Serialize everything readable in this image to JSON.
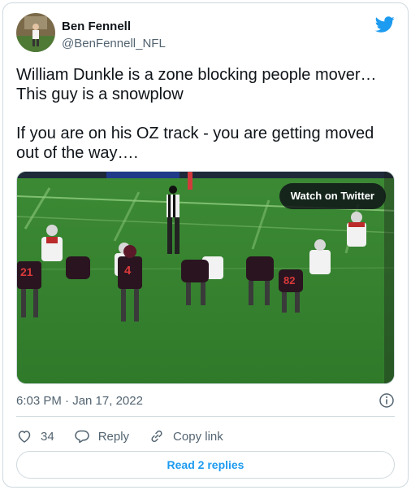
{
  "author": {
    "name": "Ben Fennell",
    "handle": "@BenFennell_NFL"
  },
  "tweet": {
    "text": "William Dunkle is a zone blocking people mover…\nThis guy is a snowplow\n\nIf you are on his OZ track - you are getting moved out of the way…."
  },
  "media": {
    "watch_label": "Watch on Twitter",
    "jersey_numbers": [
      "21",
      "4",
      "82"
    ]
  },
  "meta": {
    "timestamp": "6:03 PM · Jan 17, 2022"
  },
  "actions": {
    "like_count": "34",
    "reply_label": "Reply",
    "copy_link_label": "Copy link"
  },
  "read_replies_label": "Read 2 replies",
  "colors": {
    "accent": "#1d9bf0",
    "secondary_text": "#536471",
    "border": "#cfd9de"
  }
}
